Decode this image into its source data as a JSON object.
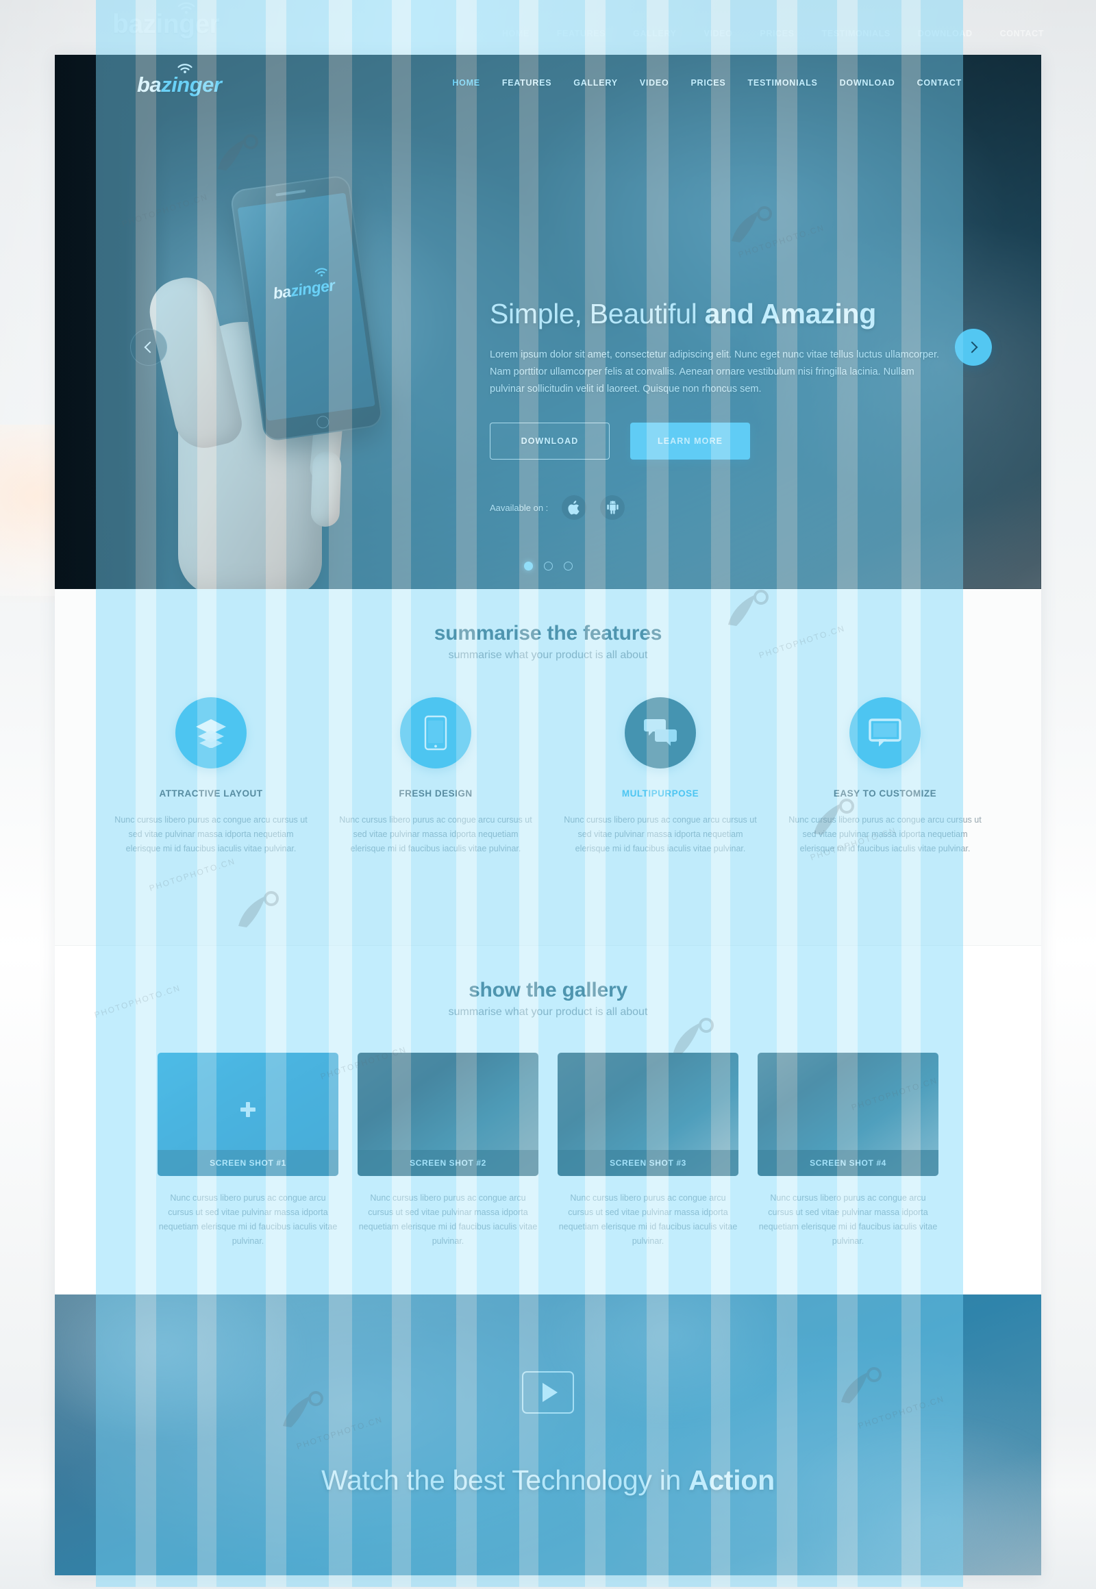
{
  "brand": {
    "name_part1": "ba",
    "name_part2": "zinger",
    "wifi_icon": "wifi-icon"
  },
  "ghost_header": {
    "logo_part1": "ba",
    "logo_part2": "zinger",
    "nav": [
      "HOME",
      "FEATURES",
      "GALLERY",
      "VIDEO",
      "PRICES",
      "TESTIMONIALS",
      "DOWNLOAD",
      "CONTACT"
    ]
  },
  "nav": {
    "items": [
      {
        "label": "HOME",
        "active": true
      },
      {
        "label": "FEATURES",
        "active": false
      },
      {
        "label": "GALLERY",
        "active": false
      },
      {
        "label": "VIDEO",
        "active": false
      },
      {
        "label": "PRICES",
        "active": false
      },
      {
        "label": "TESTIMONIALS",
        "active": false
      },
      {
        "label": "DOWNLOAD",
        "active": false
      },
      {
        "label": "CONTACT",
        "active": false
      }
    ]
  },
  "hero": {
    "heading_light": "Simple, Beautiful ",
    "heading_bold": "and Amazing",
    "paragraph": "Lorem ipsum dolor sit amet, consectetur adipiscing elit. Nunc eget nunc vitae tellus luctus ullamcorper. Nam porttitor ullamcorper felis at convallis. Aenean ornare vestibulum nisi fringilla lacinia. Nullam pulvinar sollicitudin velit id laoreet. Quisque non rhoncus sem.",
    "btn_download": "DOWNLOAD",
    "btn_learn_more": "LEARN MORE",
    "available_label": "Aavailable on :",
    "store_icons": [
      "apple-icon",
      "android-icon"
    ],
    "phone_logo_part1": "ba",
    "phone_logo_part2": "zinger",
    "prev_arrow": "chevron-left-icon",
    "next_arrow": "chevron-right-icon",
    "slides_total": 3,
    "active_slide": 1,
    "accent_color": "#4ec3f0"
  },
  "features": {
    "title": "summarise the features",
    "subtitle": "summarise what your product is all about",
    "items": [
      {
        "icon": "layers-icon",
        "icon_style": "light",
        "title": "ATTRACTIVE LAYOUT",
        "title_accent": false,
        "body": "Nunc cursus libero purus ac congue arcu cursus ut sed vitae pulvinar massa idporta nequetiam elerisque mi id faucibus iaculis vitae pulvinar."
      },
      {
        "icon": "mobile-phone-icon",
        "icon_style": "light",
        "title": "FRESH DESIGN",
        "title_accent": false,
        "body": "Nunc cursus libero purus ac congue arcu cursus ut sed vitae pulvinar massa idporta nequetiam elerisque mi id faucibus iaculis vitae pulvinar."
      },
      {
        "icon": "chat-bubbles-icon",
        "icon_style": "dark",
        "title": "MULTIPURPOSE",
        "title_accent": true,
        "body": "Nunc cursus libero purus ac congue arcu cursus ut sed vitae pulvinar massa idporta nequetiam elerisque mi id faucibus iaculis vitae pulvinar."
      },
      {
        "icon": "monitor-screen-icon",
        "icon_style": "light",
        "title": "EASY TO CUSTOMIZE",
        "title_accent": false,
        "body": "Nunc cursus libero purus ac congue arcu cursus ut sed vitae pulvinar massa idporta nequetiam elerisque mi id faucibus iaculis vitae pulvinar."
      }
    ]
  },
  "gallery": {
    "title": "show the gallery",
    "subtitle": "summarise what your product is all about",
    "plus_icon": "plus-icon",
    "items": [
      {
        "caption": "SCREEN SHOT #1",
        "hovered": true,
        "body": "Nunc cursus libero purus ac congue arcu cursus ut sed vitae pulvinar massa idporta nequetiam elerisque mi id faucibus iaculis vitae pulvinar."
      },
      {
        "caption": "SCREEN SHOT #2",
        "hovered": false,
        "body": "Nunc cursus libero purus ac congue arcu cursus ut sed vitae pulvinar massa idporta nequetiam elerisque mi id faucibus iaculis vitae pulvinar."
      },
      {
        "caption": "SCREEN SHOT #3",
        "hovered": false,
        "body": "Nunc cursus libero purus ac congue arcu cursus ut sed vitae pulvinar massa idporta nequetiam elerisque mi id faucibus iaculis vitae pulvinar."
      },
      {
        "caption": "SCREEN SHOT #4",
        "hovered": false,
        "body": "Nunc cursus libero purus ac congue arcu cursus ut sed vitae pulvinar massa idporta nequetiam elerisque mi id faucibus iaculis vitae pulvinar."
      }
    ]
  },
  "video": {
    "play_icon": "play-icon",
    "heading_light": "Watch the best Technology in ",
    "heading_bold": "Action"
  },
  "watermark": {
    "text": "PHOTOPHOTO.CN",
    "mark": "tupian-mark"
  },
  "colors": {
    "accent": "#2ab7ea",
    "accent_bright": "#53c7f2",
    "dark_teal": "#1d5e76",
    "heading": "#2d5f72",
    "muted": "#97a7af"
  }
}
